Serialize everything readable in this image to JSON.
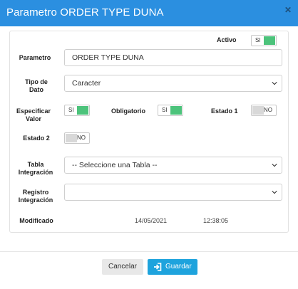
{
  "modal": {
    "title": "Parametro ORDER TYPE DUNA",
    "close_icon": "close-icon"
  },
  "form": {
    "activo": {
      "label": "Activo",
      "toggle_text": "SI",
      "state": "on"
    },
    "parametro": {
      "label": "Parametro",
      "value": "ORDER TYPE DUNA"
    },
    "tipo_dato": {
      "label_line1": "Tipo de",
      "label_line2": "Dato",
      "selected": "Caracter"
    },
    "especificar_valor": {
      "label_line1": "Especificar",
      "label_line2": "Valor",
      "toggle_text": "SI",
      "state": "on"
    },
    "obligatorio": {
      "label": "Obligatorio",
      "toggle_text": "SI",
      "state": "on"
    },
    "estado1": {
      "label": "Estado 1",
      "toggle_text": "NO",
      "state": "off"
    },
    "estado2": {
      "label": "Estado 2",
      "toggle_text": "NO",
      "state": "off"
    },
    "tabla_integracion": {
      "label_line1": "Tabla",
      "label_line2": "Integración",
      "selected": "-- Seleccione una Tabla --"
    },
    "registro_integracion": {
      "label_line1": "Registro",
      "label_line2": "Integración",
      "selected": ""
    },
    "modificado": {
      "label": "Modificado",
      "date": "14/05/2021",
      "time": "12:38:05"
    }
  },
  "footer": {
    "cancel_label": "Cancelar",
    "save_label": "Guardar",
    "save_icon": "sign-in-icon"
  },
  "colors": {
    "header": "#2b8fe0",
    "toggle_on": "#4cc37b",
    "save_button": "#1ea3dd"
  }
}
